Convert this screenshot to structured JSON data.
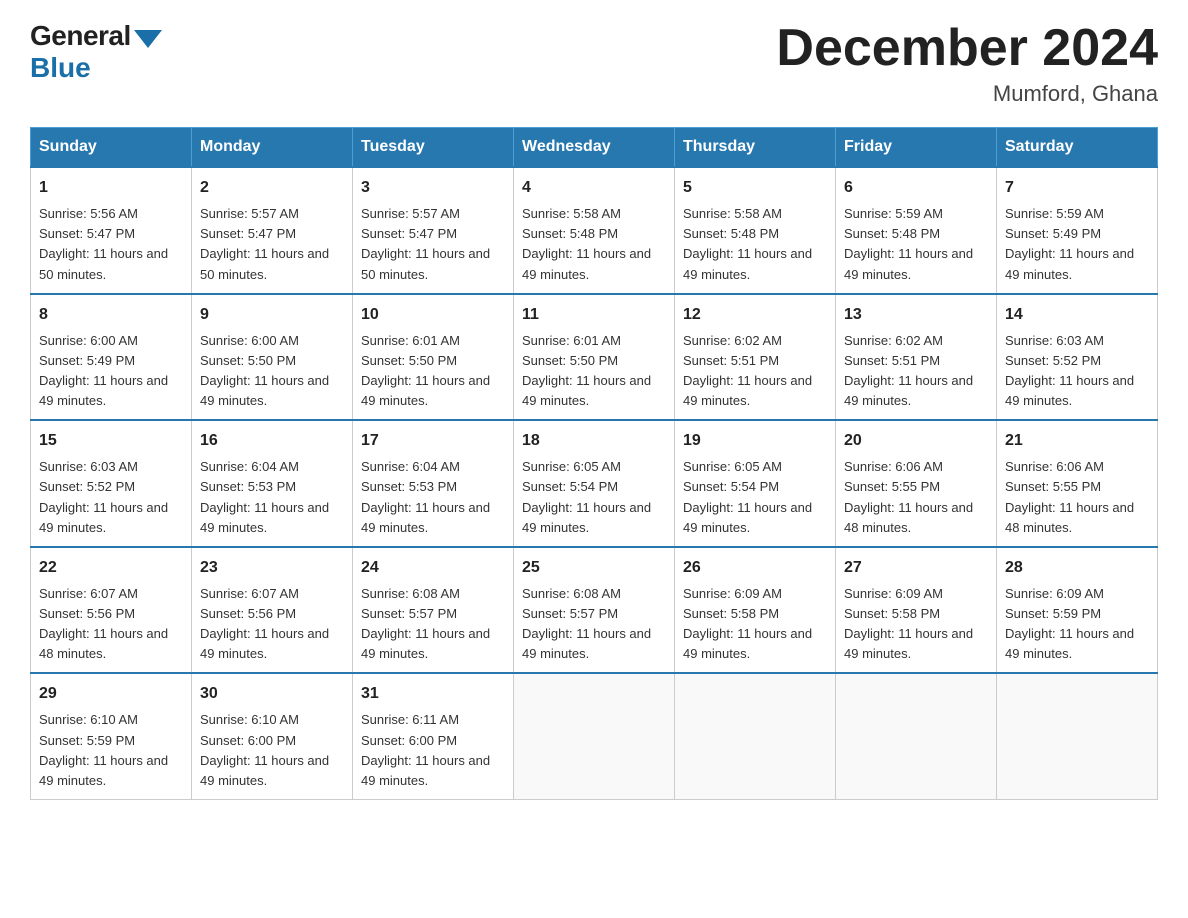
{
  "logo": {
    "general": "General",
    "blue": "Blue"
  },
  "title": "December 2024",
  "location": "Mumford, Ghana",
  "days_header": [
    "Sunday",
    "Monday",
    "Tuesday",
    "Wednesday",
    "Thursday",
    "Friday",
    "Saturday"
  ],
  "weeks": [
    [
      {
        "day": "1",
        "sunrise": "5:56 AM",
        "sunset": "5:47 PM",
        "daylight": "11 hours and 50 minutes."
      },
      {
        "day": "2",
        "sunrise": "5:57 AM",
        "sunset": "5:47 PM",
        "daylight": "11 hours and 50 minutes."
      },
      {
        "day": "3",
        "sunrise": "5:57 AM",
        "sunset": "5:47 PM",
        "daylight": "11 hours and 50 minutes."
      },
      {
        "day": "4",
        "sunrise": "5:58 AM",
        "sunset": "5:48 PM",
        "daylight": "11 hours and 49 minutes."
      },
      {
        "day": "5",
        "sunrise": "5:58 AM",
        "sunset": "5:48 PM",
        "daylight": "11 hours and 49 minutes."
      },
      {
        "day": "6",
        "sunrise": "5:59 AM",
        "sunset": "5:48 PM",
        "daylight": "11 hours and 49 minutes."
      },
      {
        "day": "7",
        "sunrise": "5:59 AM",
        "sunset": "5:49 PM",
        "daylight": "11 hours and 49 minutes."
      }
    ],
    [
      {
        "day": "8",
        "sunrise": "6:00 AM",
        "sunset": "5:49 PM",
        "daylight": "11 hours and 49 minutes."
      },
      {
        "day": "9",
        "sunrise": "6:00 AM",
        "sunset": "5:50 PM",
        "daylight": "11 hours and 49 minutes."
      },
      {
        "day": "10",
        "sunrise": "6:01 AM",
        "sunset": "5:50 PM",
        "daylight": "11 hours and 49 minutes."
      },
      {
        "day": "11",
        "sunrise": "6:01 AM",
        "sunset": "5:50 PM",
        "daylight": "11 hours and 49 minutes."
      },
      {
        "day": "12",
        "sunrise": "6:02 AM",
        "sunset": "5:51 PM",
        "daylight": "11 hours and 49 minutes."
      },
      {
        "day": "13",
        "sunrise": "6:02 AM",
        "sunset": "5:51 PM",
        "daylight": "11 hours and 49 minutes."
      },
      {
        "day": "14",
        "sunrise": "6:03 AM",
        "sunset": "5:52 PM",
        "daylight": "11 hours and 49 minutes."
      }
    ],
    [
      {
        "day": "15",
        "sunrise": "6:03 AM",
        "sunset": "5:52 PM",
        "daylight": "11 hours and 49 minutes."
      },
      {
        "day": "16",
        "sunrise": "6:04 AM",
        "sunset": "5:53 PM",
        "daylight": "11 hours and 49 minutes."
      },
      {
        "day": "17",
        "sunrise": "6:04 AM",
        "sunset": "5:53 PM",
        "daylight": "11 hours and 49 minutes."
      },
      {
        "day": "18",
        "sunrise": "6:05 AM",
        "sunset": "5:54 PM",
        "daylight": "11 hours and 49 minutes."
      },
      {
        "day": "19",
        "sunrise": "6:05 AM",
        "sunset": "5:54 PM",
        "daylight": "11 hours and 49 minutes."
      },
      {
        "day": "20",
        "sunrise": "6:06 AM",
        "sunset": "5:55 PM",
        "daylight": "11 hours and 48 minutes."
      },
      {
        "day": "21",
        "sunrise": "6:06 AM",
        "sunset": "5:55 PM",
        "daylight": "11 hours and 48 minutes."
      }
    ],
    [
      {
        "day": "22",
        "sunrise": "6:07 AM",
        "sunset": "5:56 PM",
        "daylight": "11 hours and 48 minutes."
      },
      {
        "day": "23",
        "sunrise": "6:07 AM",
        "sunset": "5:56 PM",
        "daylight": "11 hours and 49 minutes."
      },
      {
        "day": "24",
        "sunrise": "6:08 AM",
        "sunset": "5:57 PM",
        "daylight": "11 hours and 49 minutes."
      },
      {
        "day": "25",
        "sunrise": "6:08 AM",
        "sunset": "5:57 PM",
        "daylight": "11 hours and 49 minutes."
      },
      {
        "day": "26",
        "sunrise": "6:09 AM",
        "sunset": "5:58 PM",
        "daylight": "11 hours and 49 minutes."
      },
      {
        "day": "27",
        "sunrise": "6:09 AM",
        "sunset": "5:58 PM",
        "daylight": "11 hours and 49 minutes."
      },
      {
        "day": "28",
        "sunrise": "6:09 AM",
        "sunset": "5:59 PM",
        "daylight": "11 hours and 49 minutes."
      }
    ],
    [
      {
        "day": "29",
        "sunrise": "6:10 AM",
        "sunset": "5:59 PM",
        "daylight": "11 hours and 49 minutes."
      },
      {
        "day": "30",
        "sunrise": "6:10 AM",
        "sunset": "6:00 PM",
        "daylight": "11 hours and 49 minutes."
      },
      {
        "day": "31",
        "sunrise": "6:11 AM",
        "sunset": "6:00 PM",
        "daylight": "11 hours and 49 minutes."
      },
      null,
      null,
      null,
      null
    ]
  ],
  "labels": {
    "sunrise": "Sunrise:",
    "sunset": "Sunset:",
    "daylight": "Daylight:"
  },
  "colors": {
    "header_bg": "#2878b0",
    "header_text": "#ffffff",
    "border": "#999999",
    "accent_blue": "#1a6fa8"
  }
}
